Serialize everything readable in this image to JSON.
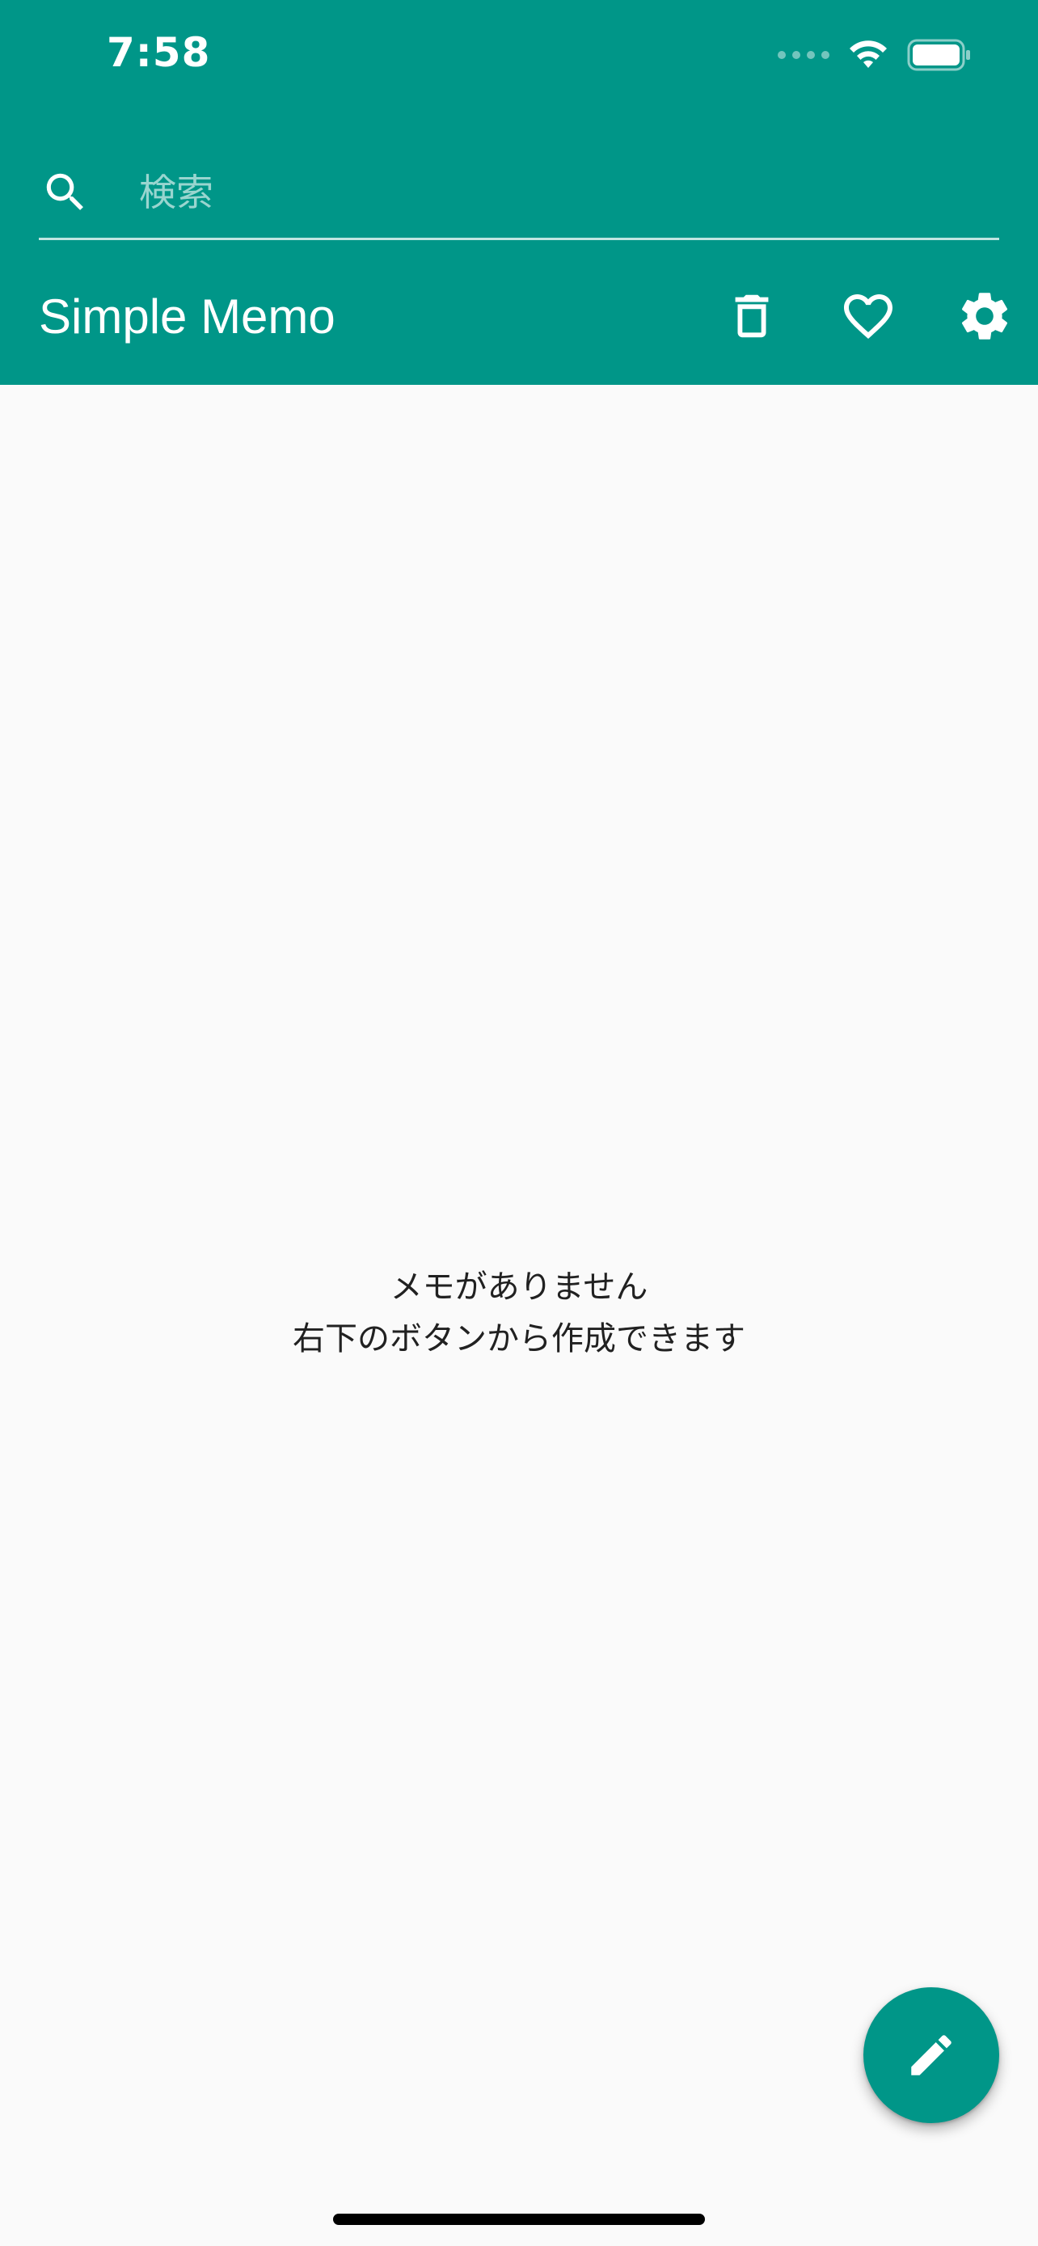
{
  "status_bar": {
    "time": "7:58",
    "icons": [
      "cellular-signal-icon",
      "wifi-icon",
      "battery-icon"
    ]
  },
  "search": {
    "placeholder": "検索",
    "value": ""
  },
  "appbar": {
    "title": "Simple Memo",
    "actions": [
      "trash-icon",
      "heart-icon",
      "gear-icon"
    ]
  },
  "empty_state": {
    "line1": "メモがありません",
    "line2": "右下のボタンから作成できます"
  },
  "fab": {
    "icon": "pencil-icon"
  },
  "colors": {
    "primary": "#009688",
    "background": "#FAFAFA",
    "text": "#212121",
    "on_primary": "#FFFFFF"
  }
}
